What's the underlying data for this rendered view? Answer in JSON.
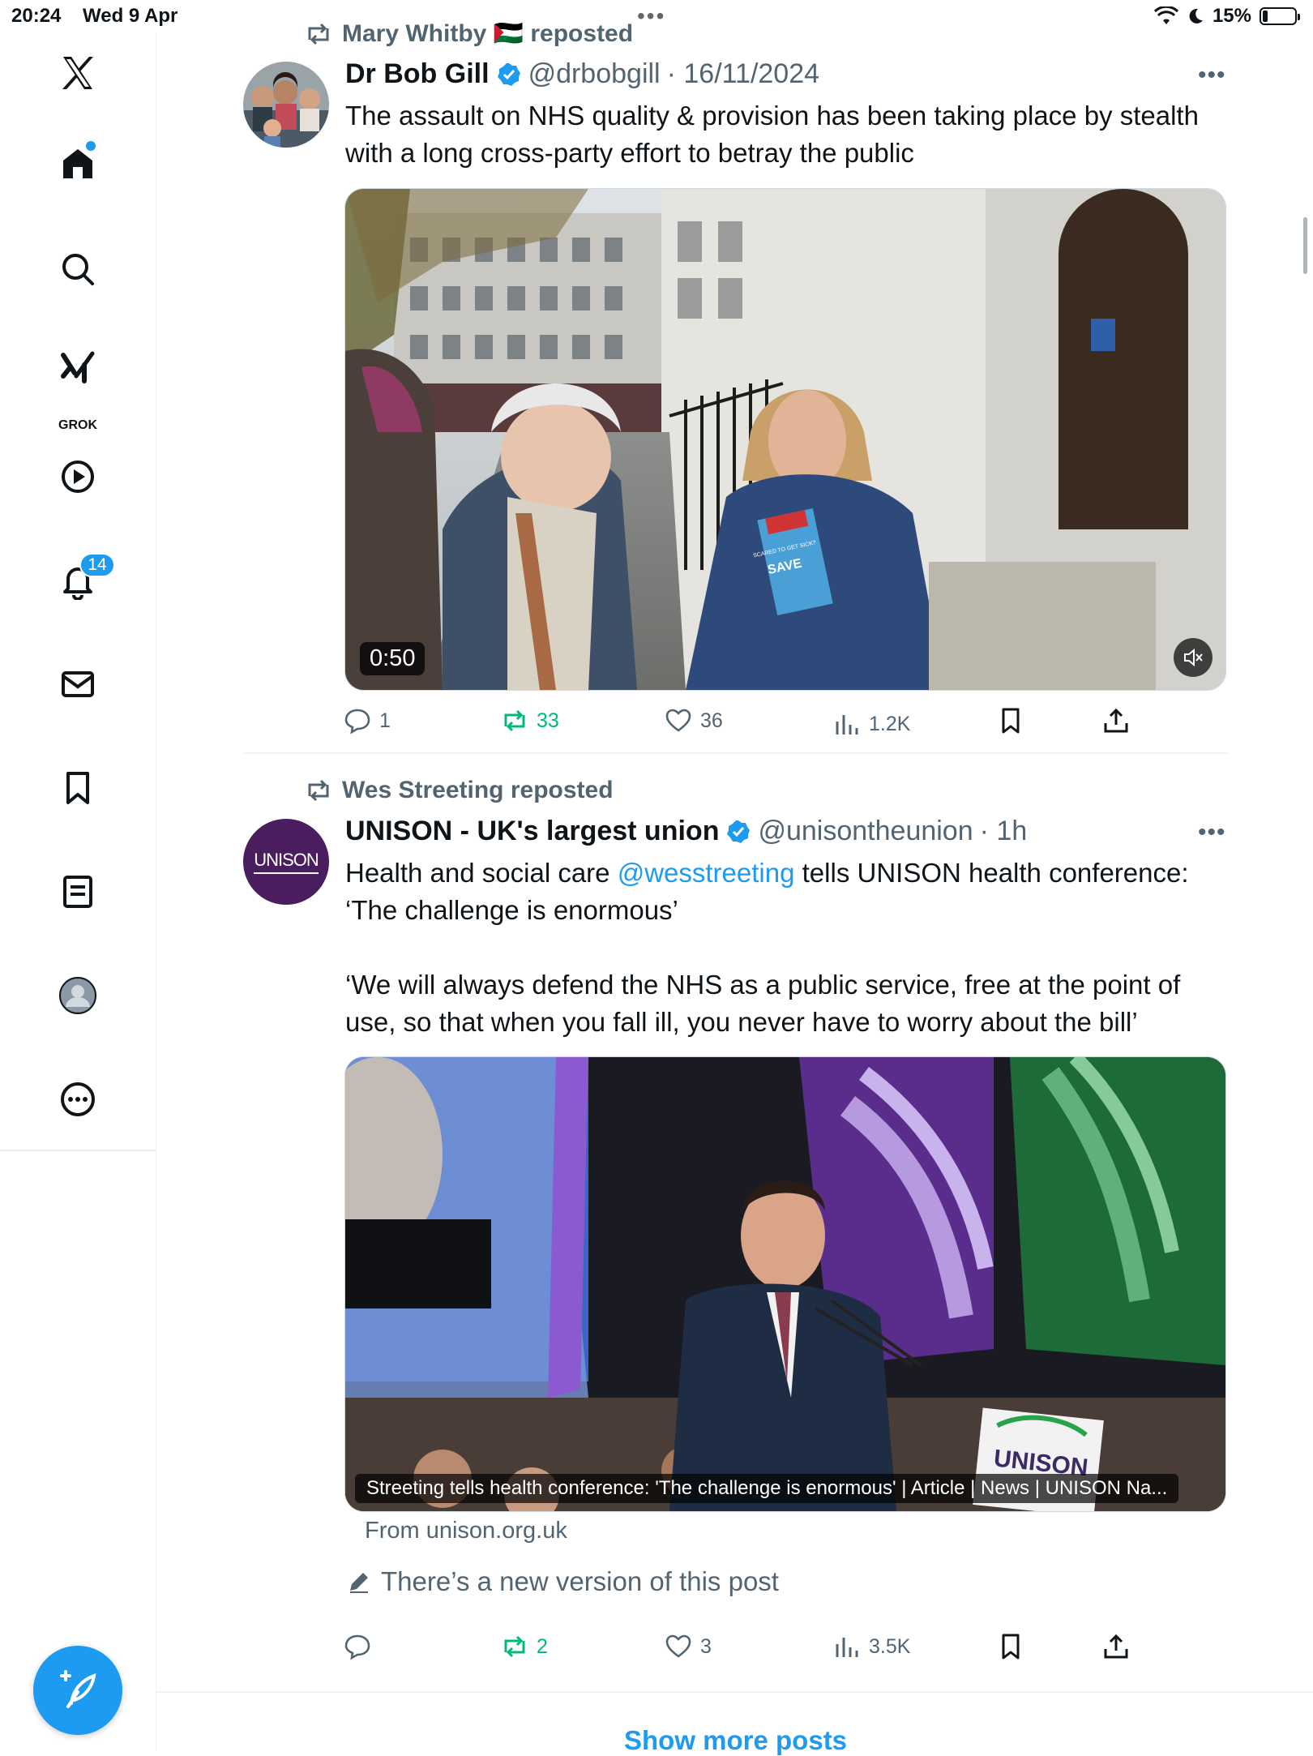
{
  "status_bar": {
    "time": "20:24",
    "date": "Wed 9 Apr",
    "battery": "15%"
  },
  "sidebar": {
    "grok_label": "GROK",
    "notifications_badge": "14",
    "icons": [
      "x-logo-icon",
      "home-icon",
      "search-icon",
      "grok-icon",
      "video-icon",
      "bell-icon",
      "mail-icon",
      "bookmark-icon",
      "list-icon",
      "profile-icon",
      "more-icon",
      "compose-icon"
    ]
  },
  "posts": [
    {
      "reposted_by": "Mary Whitby 🇵🇸 reposted",
      "name": "Dr Bob Gill",
      "handle": "@drbobgill",
      "time": "· 16/11/2024",
      "text": "The assault on NHS quality & provision has been taking place by stealth with a long cross-party effort to betray the public",
      "video_duration": "0:50",
      "media_text": {
        "book_title": "SAVE",
        "book_sub": "SCARED TO GET SICK?"
      },
      "replies": "1",
      "reposts": "33",
      "likes": "36",
      "views": "1.2K"
    },
    {
      "reposted_by": "Wes Streeting reposted",
      "name": "UNISON - UK's largest union",
      "handle": "@unisontheunion",
      "time": "· 1h",
      "avatar_text": "UNISON",
      "text_before": "Health and social care ",
      "mention": "@wesstreeting",
      "text_after": " tells UNISON health conference: ‘The challenge is enormous’",
      "text_quote": "‘We will always defend the NHS as a public service, free at the point of use, so that when you fall ill, you never have to worry about the bill’",
      "card_caption": "Streeting tells health conference: 'The challenge is enormous' | Article | News | UNISON Na...",
      "card_source": "From unison.org.uk",
      "new_version": "There’s a new version of this post",
      "podium_text": "UNISON",
      "replies": "",
      "reposts": "2",
      "likes": "3",
      "views": "3.5K"
    }
  ],
  "show_more": "Show more posts",
  "colors": {
    "accent": "#1d9bf0",
    "repost_green": "#00ba7c",
    "secondary_text": "#536471",
    "unison_purple": "#4a1d5f"
  }
}
